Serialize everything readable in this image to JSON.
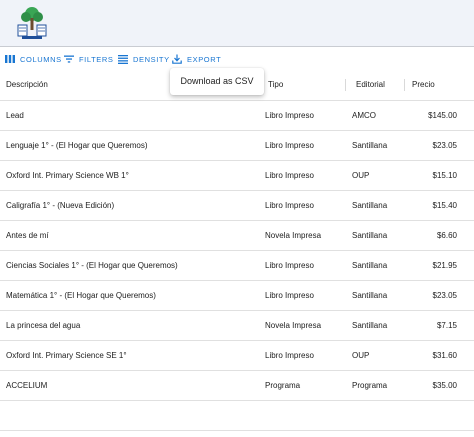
{
  "toolbar": {
    "columns_label": "COLUMNS",
    "filters_label": "FILTERS",
    "density_label": "DENSITY",
    "export_label": "EXPORT",
    "accent_color": "#1976d2"
  },
  "tooltip": {
    "text": "Download as CSV"
  },
  "table": {
    "headers": {
      "descripcion": "Descripción",
      "tipo": "Tipo",
      "editorial": "Editorial",
      "precio": "Precio"
    },
    "rows": [
      {
        "descripcion": "Lead",
        "tipo": "Libro Impreso",
        "editorial": "AMCO",
        "precio": "$145.00"
      },
      {
        "descripcion": "Lenguaje 1° - (El Hogar que Queremos)",
        "tipo": "Libro Impreso",
        "editorial": "Santillana",
        "precio": "$23.05"
      },
      {
        "descripcion": "Oxford Int. Primary Science WB 1°",
        "tipo": "Libro Impreso",
        "editorial": "OUP",
        "precio": "$15.10"
      },
      {
        "descripcion": "Caligrafía 1° - (Nueva Edición)",
        "tipo": "Libro Impreso",
        "editorial": "Santillana",
        "precio": "$15.40"
      },
      {
        "descripcion": "Antes de mí",
        "tipo": "Novela Impresa",
        "editorial": "Santillana",
        "precio": "$6.60"
      },
      {
        "descripcion": "Ciencias Sociales 1° - (El Hogar que Queremos)",
        "tipo": "Libro Impreso",
        "editorial": "Santillana",
        "precio": "$21.95"
      },
      {
        "descripcion": "Matemática 1° - (El Hogar que Queremos)",
        "tipo": "Libro Impreso",
        "editorial": "Santillana",
        "precio": "$23.05"
      },
      {
        "descripcion": "La princesa del agua",
        "tipo": "Novela Impresa",
        "editorial": "Santillana",
        "precio": "$7.15"
      },
      {
        "descripcion": "Oxford Int. Primary Science SE 1°",
        "tipo": "Libro Impreso",
        "editorial": "OUP",
        "precio": "$31.60"
      },
      {
        "descripcion": "ACCELIUM",
        "tipo": "Programa",
        "editorial": "Programa",
        "precio": "$35.00"
      }
    ]
  }
}
